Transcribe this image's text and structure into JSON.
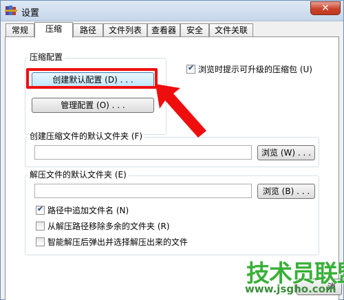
{
  "window": {
    "title": "设置",
    "close_label": "✕"
  },
  "tabs": [
    {
      "label": "常规"
    },
    {
      "label": "压缩"
    },
    {
      "label": "路径"
    },
    {
      "label": "文件列表"
    },
    {
      "label": "查看器"
    },
    {
      "label": "安全"
    },
    {
      "label": "文件关联"
    }
  ],
  "active_tab": "压缩",
  "compression_config": {
    "group_label": "压缩配置",
    "create_default_button": "创建默认配置 (D) . . .",
    "manage_button": "管理配置 (O) . . ."
  },
  "upgrade_prompt": {
    "label": "浏览时提示可升级的压缩包 (U)",
    "checked": true
  },
  "default_archive_folder": {
    "group_label": "创建压缩文件的默认文件夹 (F)",
    "value": "",
    "browse_button": "浏览 (W) . . ."
  },
  "default_extract_folder": {
    "group_label": "解压文件的默认文件夹 (E)",
    "value": "",
    "browse_button": "浏览 (B) . . ."
  },
  "extract_options": [
    {
      "label": "路径中追加文件名 (N)",
      "checked": true
    },
    {
      "label": "从解压路径移除多余的文件夹 (R)",
      "checked": false
    },
    {
      "label": "智能解压后弹出并选择解压出来的文件",
      "checked": false
    }
  ],
  "footer": {
    "cancel_button_partial": "消"
  },
  "watermark": {
    "title": "技术员联盟",
    "url": "www.jsgho.com"
  },
  "colors": {
    "highlight": "#ef0e0e",
    "watermark": "#38b038"
  }
}
